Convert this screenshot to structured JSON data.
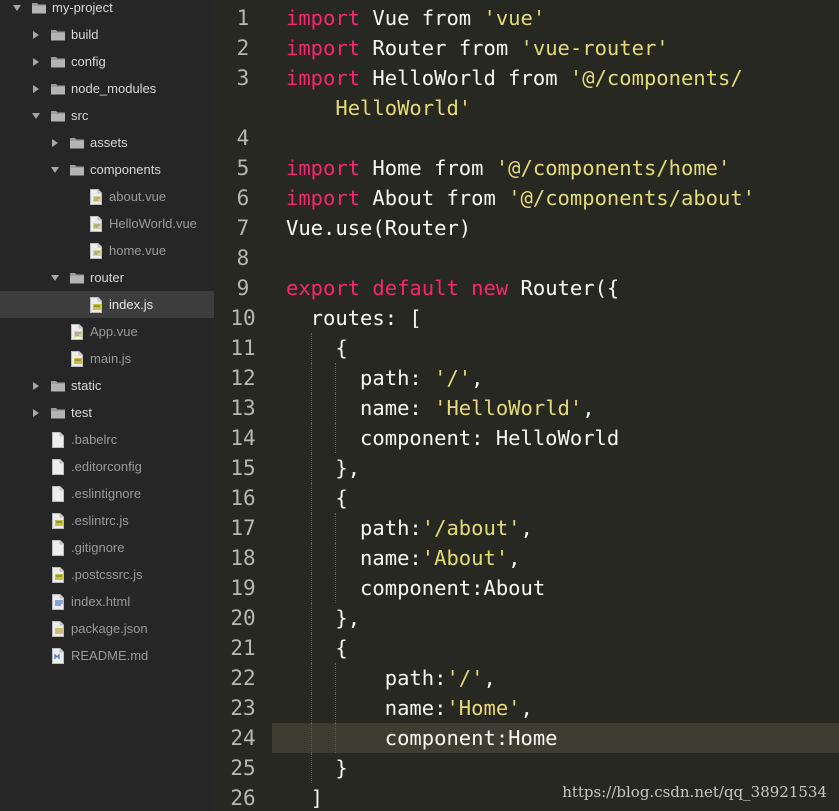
{
  "sidebar": {
    "tree": [
      {
        "name": "my-project",
        "type": "folder",
        "expanded": true,
        "depth": 0
      },
      {
        "name": "build",
        "type": "folder",
        "expanded": false,
        "depth": 1
      },
      {
        "name": "config",
        "type": "folder",
        "expanded": false,
        "depth": 1
      },
      {
        "name": "node_modules",
        "type": "folder",
        "expanded": false,
        "depth": 1
      },
      {
        "name": "src",
        "type": "folder",
        "expanded": true,
        "depth": 1
      },
      {
        "name": "assets",
        "type": "folder",
        "expanded": false,
        "depth": 2
      },
      {
        "name": "components",
        "type": "folder",
        "expanded": true,
        "depth": 2
      },
      {
        "name": "about.vue",
        "type": "file",
        "icon": "vue-file-icon",
        "depth": 3
      },
      {
        "name": "HelloWorld.vue",
        "type": "file",
        "icon": "vue-file-icon",
        "depth": 3
      },
      {
        "name": "home.vue",
        "type": "file",
        "icon": "vue-file-icon",
        "depth": 3
      },
      {
        "name": "router",
        "type": "folder",
        "expanded": true,
        "depth": 2
      },
      {
        "name": "index.js",
        "type": "file",
        "icon": "js-file-icon",
        "depth": 3,
        "selected": true
      },
      {
        "name": "App.vue",
        "type": "file",
        "icon": "vue-file-icon",
        "depth": 2
      },
      {
        "name": "main.js",
        "type": "file",
        "icon": "js-file-icon",
        "depth": 2
      },
      {
        "name": "static",
        "type": "folder",
        "expanded": false,
        "depth": 1
      },
      {
        "name": "test",
        "type": "folder",
        "expanded": false,
        "depth": 1
      },
      {
        "name": ".babelrc",
        "type": "file",
        "icon": "blank-file-icon",
        "depth": 1
      },
      {
        "name": ".editorconfig",
        "type": "file",
        "icon": "blank-file-icon",
        "depth": 1
      },
      {
        "name": ".eslintignore",
        "type": "file",
        "icon": "blank-file-icon",
        "depth": 1
      },
      {
        "name": ".eslintrc.js",
        "type": "file",
        "icon": "js-file-icon",
        "depth": 1
      },
      {
        "name": ".gitignore",
        "type": "file",
        "icon": "blank-file-icon",
        "depth": 1
      },
      {
        "name": ".postcssrc.js",
        "type": "file",
        "icon": "js-file-icon",
        "depth": 1
      },
      {
        "name": "index.html",
        "type": "file",
        "icon": "html-file-icon",
        "depth": 1
      },
      {
        "name": "package.json",
        "type": "file",
        "icon": "json-file-icon",
        "depth": 1
      },
      {
        "name": "README.md",
        "type": "file",
        "icon": "md-file-icon",
        "depth": 1
      }
    ]
  },
  "editor": {
    "current_line": 24,
    "lines": [
      {
        "n": "1",
        "tokens": [
          [
            "kw",
            "import"
          ],
          [
            "p",
            " Vue "
          ],
          [
            "p",
            "from "
          ],
          [
            "str",
            "'vue'"
          ]
        ]
      },
      {
        "n": "2",
        "tokens": [
          [
            "kw",
            "import"
          ],
          [
            "p",
            " Router "
          ],
          [
            "p",
            "from "
          ],
          [
            "str",
            "'vue-router'"
          ]
        ]
      },
      {
        "n": "3",
        "tokens": [
          [
            "kw",
            "import"
          ],
          [
            "p",
            " HelloWorld "
          ],
          [
            "p",
            "from "
          ],
          [
            "str",
            "'@/components/"
          ]
        ]
      },
      {
        "n": "",
        "tokens": [
          [
            "str",
            "    HelloWorld'"
          ]
        ]
      },
      {
        "n": "4",
        "tokens": []
      },
      {
        "n": "5",
        "tokens": [
          [
            "kw",
            "import"
          ],
          [
            "p",
            " Home "
          ],
          [
            "p",
            "from "
          ],
          [
            "str",
            "'@/components/home'"
          ]
        ]
      },
      {
        "n": "6",
        "tokens": [
          [
            "kw",
            "import"
          ],
          [
            "p",
            " About "
          ],
          [
            "p",
            "from "
          ],
          [
            "str",
            "'@/components/about'"
          ]
        ]
      },
      {
        "n": "7",
        "tokens": [
          [
            "p",
            "Vue.use(Router)"
          ]
        ]
      },
      {
        "n": "8",
        "tokens": []
      },
      {
        "n": "9",
        "tokens": [
          [
            "kw",
            "export"
          ],
          [
            "p",
            " "
          ],
          [
            "kw",
            "default"
          ],
          [
            "p",
            " "
          ],
          [
            "kw",
            "new"
          ],
          [
            "p",
            " Router({"
          ]
        ]
      },
      {
        "n": "10",
        "tokens": [
          [
            "p",
            "  routes: ["
          ]
        ]
      },
      {
        "n": "11",
        "tokens": [
          [
            "p",
            "    {"
          ]
        ]
      },
      {
        "n": "12",
        "tokens": [
          [
            "p",
            "      path: "
          ],
          [
            "str",
            "'/'"
          ],
          [
            "p",
            ","
          ]
        ]
      },
      {
        "n": "13",
        "tokens": [
          [
            "p",
            "      name: "
          ],
          [
            "str",
            "'HelloWorld'"
          ],
          [
            "p",
            ","
          ]
        ]
      },
      {
        "n": "14",
        "tokens": [
          [
            "p",
            "      component: HelloWorld"
          ]
        ]
      },
      {
        "n": "15",
        "tokens": [
          [
            "p",
            "    },"
          ]
        ]
      },
      {
        "n": "16",
        "tokens": [
          [
            "p",
            "    {"
          ]
        ]
      },
      {
        "n": "17",
        "tokens": [
          [
            "p",
            "      path:"
          ],
          [
            "str",
            "'/about'"
          ],
          [
            "p",
            ","
          ]
        ]
      },
      {
        "n": "18",
        "tokens": [
          [
            "p",
            "      name:"
          ],
          [
            "str",
            "'About'"
          ],
          [
            "p",
            ","
          ]
        ]
      },
      {
        "n": "19",
        "tokens": [
          [
            "p",
            "      component:About"
          ]
        ]
      },
      {
        "n": "20",
        "tokens": [
          [
            "p",
            "    },"
          ]
        ]
      },
      {
        "n": "21",
        "tokens": [
          [
            "p",
            "    {"
          ]
        ]
      },
      {
        "n": "22",
        "tokens": [
          [
            "p",
            "        path:"
          ],
          [
            "str",
            "'/'"
          ],
          [
            "p",
            ","
          ]
        ]
      },
      {
        "n": "23",
        "tokens": [
          [
            "p",
            "        name:"
          ],
          [
            "str",
            "'Home'"
          ],
          [
            "p",
            ","
          ]
        ]
      },
      {
        "n": "24",
        "tokens": [
          [
            "p",
            "        component:Home"
          ]
        ]
      },
      {
        "n": "25",
        "tokens": [
          [
            "p",
            "    }"
          ]
        ]
      },
      {
        "n": "26",
        "tokens": [
          [
            "p",
            "  ]"
          ]
        ]
      }
    ]
  },
  "watermark": "https://blog.csdn.net/qq_38921534",
  "colors": {
    "background": "#272822",
    "sidebar": "#262626",
    "keyword": "#f92672",
    "string": "#e6db74",
    "text": "#f8f8f2",
    "current_line": "#3e3d32"
  }
}
